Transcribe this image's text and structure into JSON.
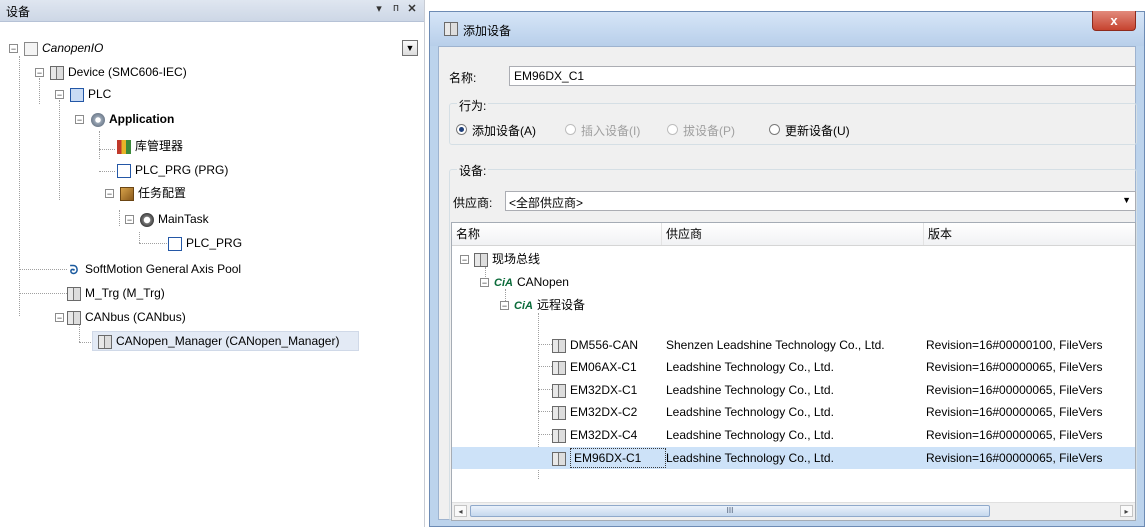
{
  "left_panel": {
    "title": "设备",
    "pin_glyph": "▾",
    "dock_glyph": "ᴨ",
    "close_glyph": "✕",
    "tree": {
      "project": "CanopenIO",
      "device": "Device (SMC606-IEC)",
      "plc": "PLC",
      "application": "Application",
      "library_manager": "库管理器",
      "plc_prg": "PLC_PRG (PRG)",
      "task_config": "任务配置",
      "main_task": "MainTask",
      "main_task_prg": "PLC_PRG",
      "softmotion": "SoftMotion General Axis Pool",
      "m_trg": "M_Trg (M_Trg)",
      "canbus": "CANbus (CANbus)",
      "canopen_manager": "CANopen_Manager (CANopen_Manager)"
    }
  },
  "dialog": {
    "title": "添加设备",
    "close_glyph": "x",
    "name_label": "名称:",
    "name_value": "EM96DX_C1",
    "action_group_label": "行为:",
    "actions": [
      {
        "label": "添加设备(A)",
        "selected": true,
        "enabled": true
      },
      {
        "label": "插入设备(I)",
        "selected": false,
        "enabled": false
      },
      {
        "label": "拔设备(P)",
        "selected": false,
        "enabled": false
      },
      {
        "label": "更新设备(U)",
        "selected": false,
        "enabled": true
      }
    ],
    "device_group_label": "设备:",
    "vendor_label": "供应商:",
    "vendor_value": "<全部供应商>",
    "columns": [
      "名称",
      "供应商",
      "版本"
    ],
    "tree": {
      "fieldbus": "现场总线",
      "canopen": "CANopen",
      "remote": "远程设备",
      "cia_mark": "CiA"
    },
    "devices": [
      {
        "name": "DM556-CAN",
        "vendor": "Shenzen Leadshine Technology Co., Ltd.",
        "version": "Revision=16#00000100, FileVers"
      },
      {
        "name": "EM06AX-C1",
        "vendor": "Leadshine Technology Co., Ltd.",
        "version": "Revision=16#00000065, FileVers"
      },
      {
        "name": "EM32DX-C1",
        "vendor": "Leadshine Technology Co., Ltd.",
        "version": "Revision=16#00000065, FileVers"
      },
      {
        "name": "EM32DX-C2",
        "vendor": "Leadshine Technology Co., Ltd.",
        "version": "Revision=16#00000065, FileVers"
      },
      {
        "name": "EM32DX-C4",
        "vendor": "Leadshine Technology Co., Ltd.",
        "version": "Revision=16#00000065, FileVers"
      },
      {
        "name": "EM96DX-C1",
        "vendor": "Leadshine Technology Co., Ltd.",
        "version": "Revision=16#00000065, FileVers"
      }
    ],
    "selected_device_index": 5,
    "hscroll": {
      "left_glyph": "◂",
      "right_glyph": "▸",
      "thumb_glyph": "III"
    }
  },
  "colors": {
    "selection": "#cde2f8",
    "title_gradient_top": "#d6e5f7",
    "close": "#c6432f"
  }
}
